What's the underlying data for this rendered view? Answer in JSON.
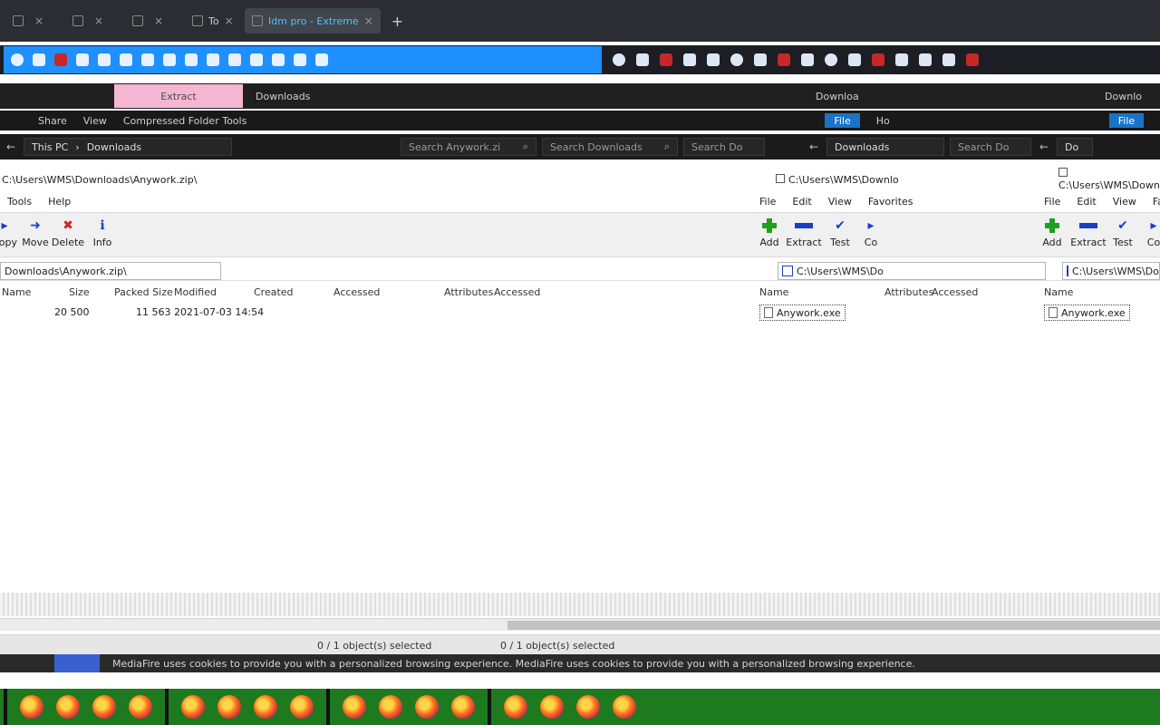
{
  "browser": {
    "tabs": [
      {
        "label": "",
        "active": false
      },
      {
        "label": "",
        "active": false
      },
      {
        "label": "",
        "active": false
      },
      {
        "label": "To",
        "active": false
      },
      {
        "label": "Idm pro - Extreme",
        "active": true
      }
    ],
    "new_tab_symbol": "+"
  },
  "bookmarks": {
    "left_icons": [
      "globe-icon",
      "page-icon",
      "pdf-icon",
      "chevron-icon",
      "folder-icon",
      "grid-icon",
      "page-icon",
      "star-icon",
      "globe-icon",
      "page-icon",
      "pdf-icon",
      "chevron-icon"
    ],
    "right_icons": [
      "grid-icon",
      "globe-icon",
      "page-icon",
      "pdf-icon",
      "chevron-icon",
      "globe-icon",
      "page-icon",
      "pdf-icon",
      "chevron-icon",
      "grid-icon",
      "globe-icon",
      "page-icon",
      "pdf-icon"
    ]
  },
  "explorer": {
    "ribbon": {
      "extract_tab": "Extract",
      "downloads_tab": "Downloads",
      "right_title_1": "Downloa",
      "right_title_2": "Downlo"
    },
    "menu": {
      "items": [
        "Share",
        "View",
        "Compressed Folder Tools"
      ],
      "file_chip": "File",
      "mid_label": "Ho"
    },
    "address": {
      "back_symbol": "←",
      "crumbs": [
        "This PC",
        "Downloads"
      ],
      "search_placeholder_1": "Search Anywork.zi",
      "search_placeholder_2": "Search Downloads",
      "search_placeholder_3": "Search Do",
      "search_placeholder_4": "Sear",
      "right_crumb_1": "Downloads",
      "right_crumb_2": "Do"
    }
  },
  "archive": {
    "title_1": "C:\\Users\\WMS\\Downloads\\Anywork.zip\\",
    "title_2": "C:\\Users\\WMS\\Downlo",
    "title_3": "C:\\Users\\WMS\\Downl",
    "menu_left": [
      "Tools",
      "Help"
    ],
    "menu_right_1": [
      "File",
      "Edit",
      "View",
      "Favorites"
    ],
    "menu_right_2": [
      "File",
      "Edit",
      "View",
      "Favorites"
    ],
    "toolbar_left": [
      {
        "label": "Copy",
        "icon": "copy-icon"
      },
      {
        "label": "Move",
        "icon": "move-icon"
      },
      {
        "label": "Delete",
        "icon": "delete-icon"
      },
      {
        "label": "Info",
        "icon": "info-icon"
      }
    ],
    "toolbar_right": [
      {
        "label": "Add",
        "icon": "add-icon"
      },
      {
        "label": "Extract",
        "icon": "extract-icon"
      },
      {
        "label": "Test",
        "icon": "test-icon"
      },
      {
        "label": "Co",
        "icon": "copy-icon"
      }
    ],
    "toolbar_right_2": [
      {
        "label": "Add",
        "icon": "add-icon"
      },
      {
        "label": "Extract",
        "icon": "extract-icon"
      },
      {
        "label": "Test",
        "icon": "test-icon"
      },
      {
        "label": "Co",
        "icon": "copy-icon"
      }
    ],
    "path_left": "Downloads\\Anywork.zip\\",
    "path_right_1": "C:\\Users\\WMS\\Do",
    "path_right_2": "C:\\Users\\WMS\\Do",
    "columns_left": [
      "Name",
      "Size",
      "Packed Size",
      "Modified",
      "Created",
      "Accessed",
      "Attributes",
      "Accessed"
    ],
    "columns_right_1": [
      "Name",
      "Attributes",
      "Accessed"
    ],
    "columns_right_2": [
      "Name"
    ],
    "row": {
      "size": "20 500",
      "packed": "11 563",
      "modified": "2021-07-03 14:54",
      "name_right_1": "Anywork.exe",
      "name_right_2": "Anywork.exe"
    },
    "status_left": "0 / 1 object(s) selected",
    "status_mid": "0 / 1 object(s) selected"
  },
  "cookie_banner": "MediaFire uses cookies to provide you with a personalized browsing experience. MediaFire uses cookies to provide you with a personalized browsing experience.",
  "taskbar": {
    "app_icon": "firefox-icon",
    "count": 16
  },
  "colors": {
    "bookmarks_accent": "#1e90ff",
    "extract_tab": "#f4b6d2",
    "taskbar": "#1e7a1e",
    "file_chip": "#1a73c7"
  }
}
